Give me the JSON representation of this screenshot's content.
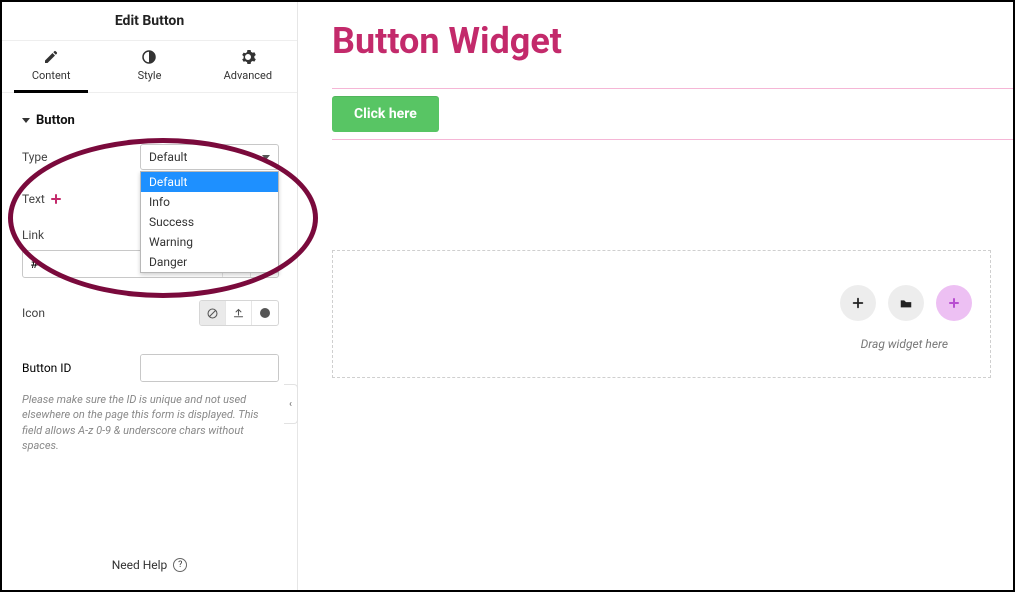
{
  "sidebar": {
    "title": "Edit Button",
    "tabs": {
      "content": "Content",
      "style": "Style",
      "advanced": "Advanced"
    },
    "section_label": "Button",
    "fields": {
      "type": {
        "label": "Type",
        "value": "Default",
        "options": [
          "Default",
          "Info",
          "Success",
          "Warning",
          "Danger"
        ]
      },
      "text": {
        "label": "Text"
      },
      "link": {
        "label": "Link",
        "value": "#"
      },
      "icon": {
        "label": "Icon"
      },
      "button_id": {
        "label": "Button ID",
        "value": "",
        "hint": "Please make sure the ID is unique and not used elsewhere on the page this form is displayed. This field allows A-z 0-9 & underscore chars without spaces."
      }
    },
    "need_help": "Need Help"
  },
  "main": {
    "heading": "Button Widget",
    "button_label": "Click here",
    "dropzone_hint": "Drag widget here"
  }
}
